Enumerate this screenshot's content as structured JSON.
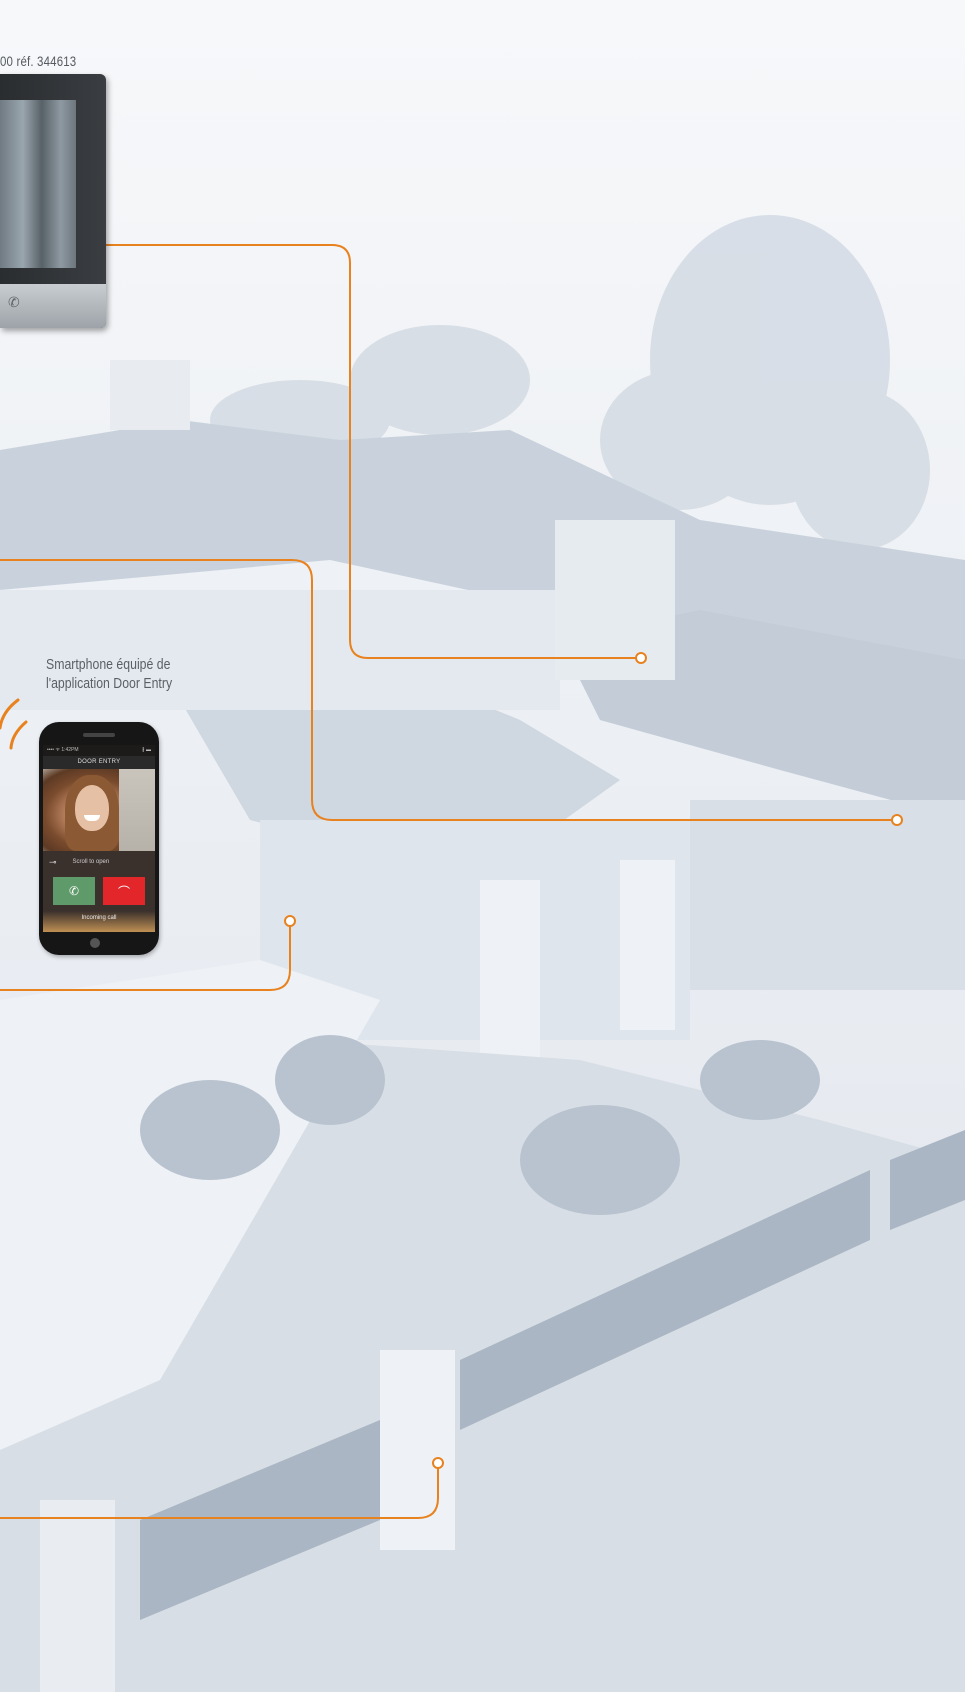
{
  "captions": {
    "monitor_ref": "00 réf. 344613",
    "phone_line1": "Smartphone équipé de",
    "phone_line2": "l'application Door Entry"
  },
  "phone": {
    "status_left": "•••• ᯤ  1:42PM",
    "status_right": "∦ ▬",
    "app_title": "DOOR ENTRY",
    "scroll_label": "Scroll to open",
    "incoming_label": "Incoming call",
    "answer_icon": "phone-answer-icon",
    "reject_icon": "phone-hangup-icon"
  },
  "colors": {
    "accent_line": "#e8821f",
    "answer": "#5f9b6a",
    "reject": "#e2262a"
  }
}
